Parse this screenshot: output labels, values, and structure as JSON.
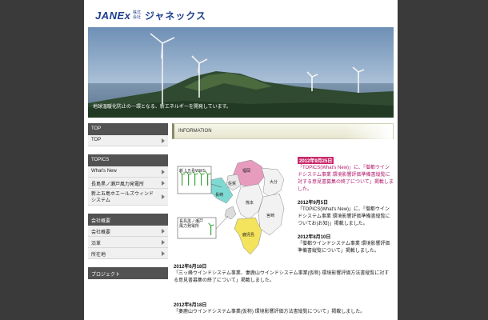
{
  "header": {
    "logo_text": "JANEx",
    "logo_kk": "株式会社",
    "company_name": "ジャネックス"
  },
  "banner": {
    "tagline": "地球温暖化防止の一環となる、新エネルギーを開発しています。"
  },
  "sidebar": {
    "groups": [
      {
        "head": "TOP",
        "items": [
          {
            "label": "TOP"
          }
        ]
      },
      {
        "head": "TOPICS",
        "items": [
          {
            "label": "What's New"
          },
          {
            "label": "長島黒ノ瀬戸風力発電所"
          },
          {
            "label": "新上五島ホエールズウィンドシステム"
          }
        ]
      },
      {
        "head": "会社概要",
        "items": [
          {
            "label": "会社概要"
          },
          {
            "label": "沿革"
          },
          {
            "label": "所在地"
          }
        ]
      },
      {
        "head": "プロジェクト",
        "items": []
      }
    ]
  },
  "main": {
    "info_title": "INFORMATION",
    "map": {
      "labels": {
        "kamigoto": "新上五島WWS",
        "nagashima": "長島黒ノ瀬戸\n風力発電所",
        "nagashima_line1": "長島黒ノ瀬戸",
        "nagashima_line2": "風力発電所",
        "fukuoka": "福岡",
        "saga": "佐賀",
        "nagasaki": "長崎",
        "kumamoto": "熊本",
        "oita": "大分",
        "miyazaki": "宮崎",
        "kagoshima": "鹿児島"
      }
    },
    "news": [
      {
        "date": "2012年9月25日",
        "text": "「TOPICS(What's New)」に、「僧都ウインドシステム事業 環境影響評価準備書縦覧に対する意見書募集の終了について」掲載しました。"
      },
      {
        "date": "2012年9月5日",
        "text": "「TOPICS(What's New)」に、「僧都ウインドシステム事業 環境影響評価準備書縦覧についてお(お知)」掲載しました。"
      },
      {
        "date": "2012年8月10日",
        "text": "「僧都ウインドシステム事業 環境影響評価準備書縦覧について」掲載しました。"
      }
    ],
    "news_wide": [
      {
        "date": "2012年6月18日",
        "text": "「三ッ峰ウインドシステム事業、妻鹿山ウインドシステム事業(仮称) 環境影響評価方法書縦覧に対する意見書募集の終了について」掲載しました。"
      },
      {
        "date": "2012年6月18日",
        "text": "「妻鹿山ウインドシステム事業(仮称) 環境影響評価方法書縦覧について」掲載しました。"
      }
    ]
  },
  "colors": {
    "background": "#3a3a3a",
    "nav_head": "#525252",
    "logo": "#1f3f8f",
    "highlight_date": "#c8286a",
    "fukuoka": "#e79bbd",
    "nagasaki": "#7ed9d2",
    "kagoshima": "#f4e35c"
  }
}
